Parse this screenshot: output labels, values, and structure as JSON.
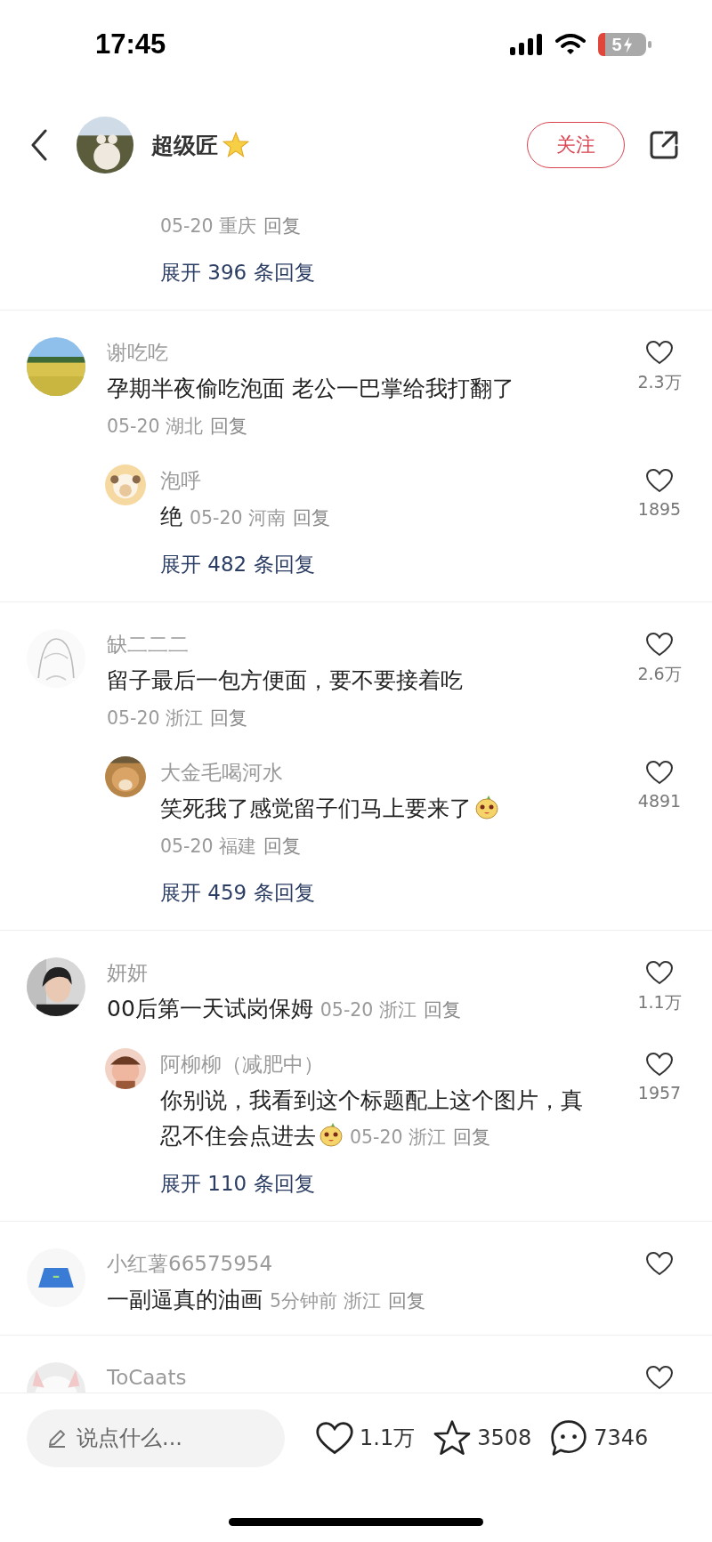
{
  "status_bar": {
    "time": "17:45",
    "battery": "5"
  },
  "header": {
    "author": "超级匠",
    "follow": "关注"
  },
  "partial_thread": {
    "date": "05-20",
    "location": "重庆",
    "reply": "回复",
    "expand": "展开 396 条回复"
  },
  "comments": [
    {
      "user": "谢吃吃",
      "text_lines": [
        "孕期半夜偷吃泡面 老公一巴掌给我打翻了"
      ],
      "meta_below": {
        "date": "05-20",
        "location": "湖北",
        "reply": "回复"
      },
      "likes": "2.3万",
      "expand": "展开 482 条回复",
      "replies": [
        {
          "user": "泡呼",
          "text_lines": [
            "绝"
          ],
          "meta_inline": {
            "date": "05-20",
            "location": "河南",
            "reply": "回复"
          },
          "likes": "1895"
        }
      ]
    },
    {
      "user": "缺二二二",
      "text_lines": [
        "留子最后一包方便面，要不要接着吃"
      ],
      "meta_below": {
        "date": "05-20",
        "location": "浙江",
        "reply": "回复"
      },
      "likes": "2.6万",
      "expand": "展开 459 条回复",
      "replies": [
        {
          "user": "大金毛喝河水",
          "text_lines": [
            "笑死我了感觉留子们马上要来了"
          ],
          "emoji": true,
          "meta_below": {
            "date": "05-20",
            "location": "福建",
            "reply": "回复"
          },
          "likes": "4891"
        }
      ]
    },
    {
      "user": "妍妍",
      "text_lines": [
        "00后第一天试岗保姆"
      ],
      "meta_inline": {
        "date": "05-20",
        "location": "浙江",
        "reply": "回复"
      },
      "likes": "1.1万",
      "expand": "展开 110 条回复",
      "replies": [
        {
          "user": "阿柳柳（减肥中）",
          "text_lines": [
            "你别说，我看到这个标题配上这个图片，真",
            "忍不住会点进去"
          ],
          "emoji": true,
          "meta_inline": {
            "date": "05-20",
            "location": "浙江",
            "reply": "回复"
          },
          "likes": "1957"
        }
      ]
    },
    {
      "user": "小红薯66575954",
      "text_lines": [
        "一副逼真的油画"
      ],
      "meta_inline": {
        "date": "5分钟前",
        "location": "浙江",
        "reply": "回复"
      }
    },
    {
      "user": "ToCaats"
    }
  ],
  "bottom_bar": {
    "placeholder": "说点什么...",
    "likes": "1.1万",
    "stars": "3508",
    "comments": "7346"
  }
}
